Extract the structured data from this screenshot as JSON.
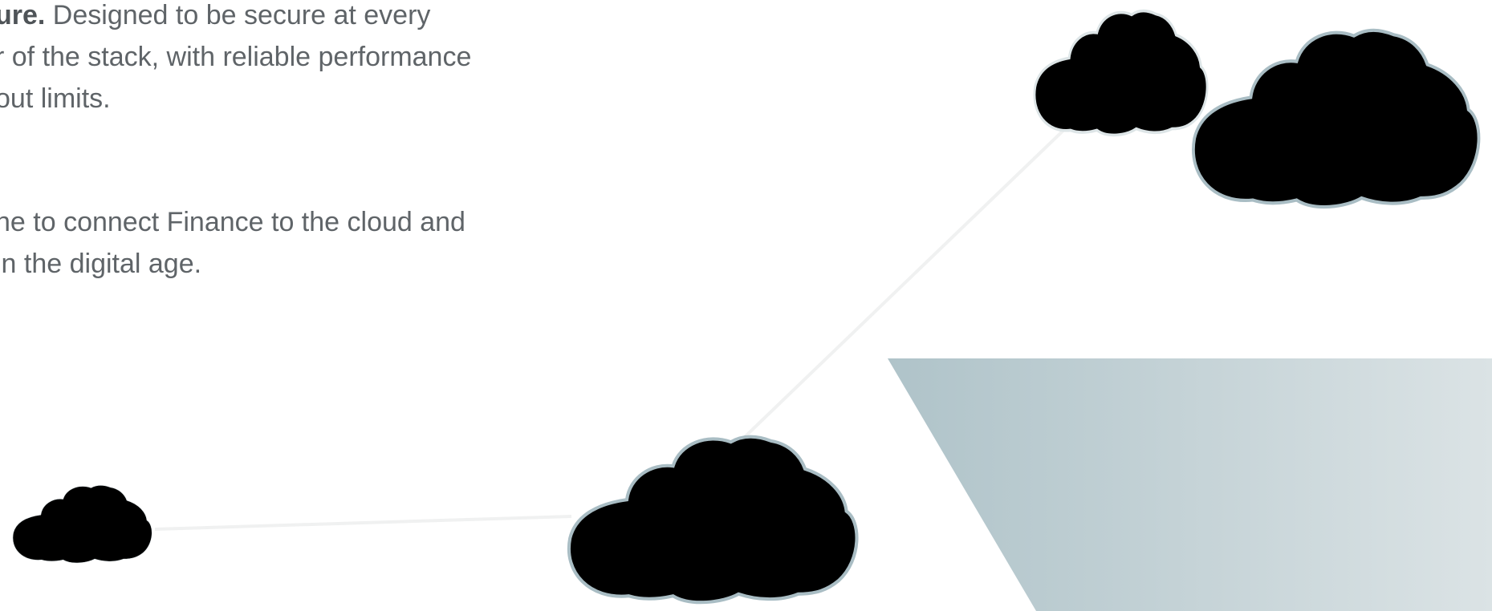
{
  "content": {
    "para1": {
      "line1_bold": "ure.",
      "line1_rest": " Designed to be secure at every",
      "line2": "r of the stack, with reliable performance",
      "line3": "out limits."
    },
    "para2": {
      "line1": "ne to connect Finance to the cloud and",
      "line2": "in the digital age."
    }
  },
  "graphic": {
    "icons": [
      "cloud-icon",
      "cloud-icon",
      "cloud-icon",
      "cloud-icon"
    ],
    "colors": {
      "cloud_stroke_dark": "#a9bdc4",
      "cloud_stroke_light": "#dde5e7",
      "connector_line": "#f0f1f1",
      "panel_gradient_start": "#afc3c9",
      "panel_gradient_end": "#dbe3e5"
    }
  }
}
